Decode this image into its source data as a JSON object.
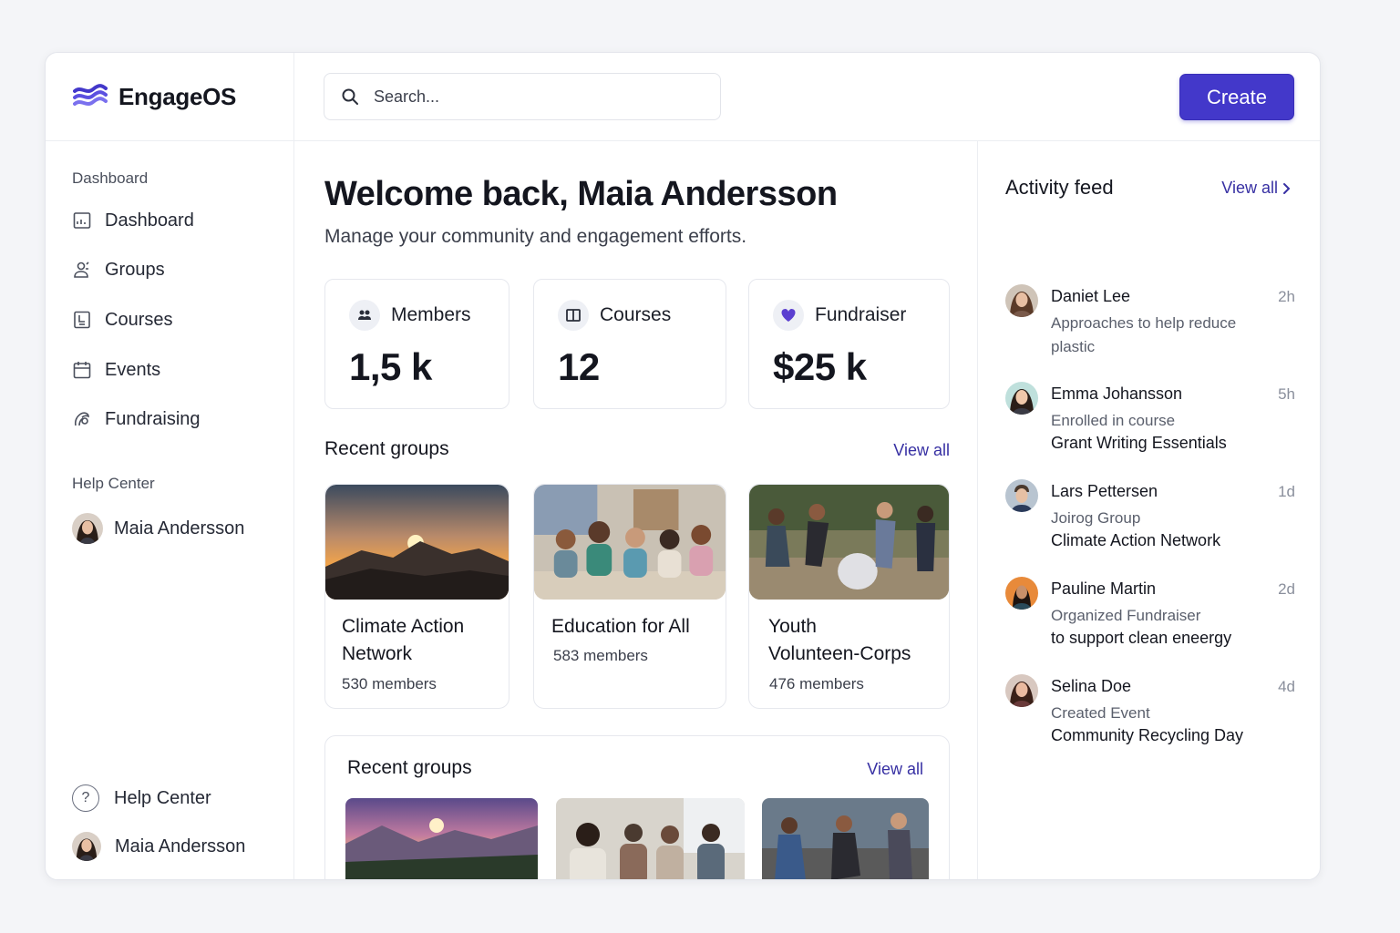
{
  "brand": {
    "name": "EngageOS",
    "accent": "#4338ca"
  },
  "search": {
    "placeholder": "Search..."
  },
  "toolbar": {
    "create_label": "Create"
  },
  "sidebar": {
    "section_dashboard": "Dashboard",
    "items": [
      {
        "label": "Dashboard",
        "icon": "dashboard-icon"
      },
      {
        "label": "Groups",
        "icon": "groups-icon"
      },
      {
        "label": "Courses",
        "icon": "courses-icon"
      },
      {
        "label": "Events",
        "icon": "calendar-icon"
      },
      {
        "label": "Fundraising",
        "icon": "fundraising-icon"
      }
    ],
    "section_help": "Help Center",
    "user_name": "Maia Andersson",
    "footer_help": "Help Center",
    "footer_user": "Maia Andersson"
  },
  "main": {
    "welcome": "Welcome back, Maia Andersson",
    "subtitle": "Manage your community and engagement efforts.",
    "stats": [
      {
        "label": "Members",
        "value": "1,5 k",
        "icon": "members-icon"
      },
      {
        "label": "Courses",
        "value": "12",
        "icon": "book-icon"
      },
      {
        "label": "Fundraiser",
        "value": "$25 k",
        "icon": "heart-icon"
      }
    ],
    "recent_groups_title": "Recent groups",
    "view_all": "View all",
    "groups": [
      {
        "name_line1": "Climate Action",
        "name_line2": "Network",
        "members": "530 members"
      },
      {
        "name_line1": "Education for All",
        "name_line2": "",
        "members": "583 members"
      },
      {
        "name_line1": "Youth",
        "name_line2": "Volunteen-Corps",
        "members": "476 members"
      }
    ],
    "lower_title": "Recent groups",
    "lower_view_all": "View all"
  },
  "activity": {
    "title": "Activity feed",
    "view_all": "View all",
    "items": [
      {
        "name": "Daniet Lee",
        "time": "2h",
        "line1": "Approaches to help reduce plastic",
        "line2": ""
      },
      {
        "name": "Emma Johansson",
        "time": "5h",
        "line1": "Enrolled in course",
        "line2": "Grant Writing Essentials"
      },
      {
        "name": "Lars Pettersen",
        "time": "1d",
        "line1": "Joirog Group",
        "line2": "Climate Action Network"
      },
      {
        "name": "Pauline Martin",
        "time": "2d",
        "line1": "Organized Fundraiser",
        "line2": "to support clean eneergy"
      },
      {
        "name": "Selina Doe",
        "time": "4d",
        "line1": "Created Event",
        "line2": "Community Recycling Day"
      }
    ]
  }
}
